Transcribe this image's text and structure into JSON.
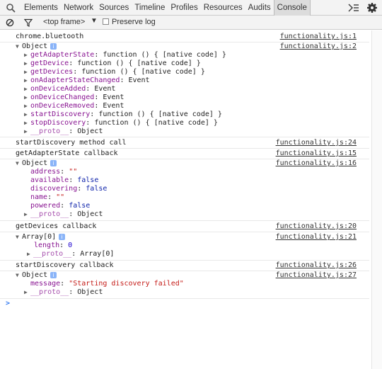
{
  "toolbar": {
    "tabs": [
      "Elements",
      "Network",
      "Sources",
      "Timeline",
      "Profiles",
      "Resources",
      "Audits",
      "Console"
    ],
    "active_tab": "Console"
  },
  "filterbar": {
    "context": "<top frame>",
    "preserve_log": "Preserve log"
  },
  "console": {
    "chrome_bluetooth": "chrome.bluetooth",
    "object": "Object",
    "members": [
      {
        "key": "getAdapterState",
        "value": ": function () { [native code] }"
      },
      {
        "key": "getDevice",
        "value": ": function () { [native code] }"
      },
      {
        "key": "getDevices",
        "value": ": function () { [native code] }"
      },
      {
        "key": "onAdapterStateChanged",
        "value": ": Event"
      },
      {
        "key": "onDeviceAdded",
        "value": ": Event"
      },
      {
        "key": "onDeviceChanged",
        "value": ": Event"
      },
      {
        "key": "onDeviceRemoved",
        "value": ": Event"
      },
      {
        "key": "startDiscovery",
        "value": ": function () { [native code] }"
      },
      {
        "key": "stopDiscovery",
        "value": ": function () { [native code] }"
      },
      {
        "key": "__proto__",
        "value": ": Object"
      }
    ],
    "start_call": "startDiscovery method call",
    "adapter_callback": "getAdapterState callback",
    "adapter_props": [
      {
        "key": "address",
        "value": "\"\"",
        "kind": "str"
      },
      {
        "key": "available",
        "value": "false",
        "kind": "kw"
      },
      {
        "key": "discovering",
        "value": "false",
        "kind": "kw"
      },
      {
        "key": "name",
        "value": "\"\"",
        "kind": "str"
      },
      {
        "key": "powered",
        "value": "false",
        "kind": "kw"
      }
    ],
    "proto": "__proto__",
    "proto_object": ": Object",
    "devices_callback": "getDevices callback",
    "array0": "Array[0]",
    "length_key": "length",
    "length_val": "0",
    "proto_array": ": Array[0]",
    "discovery_callback": "startDiscovery callback",
    "message_key": "message",
    "message_val": "\"Starting discovery failed\"",
    "prompt": ">",
    "sources": {
      "s1": "functionality.js:1",
      "s2": "functionality.js:2",
      "s24": "functionality.js:24",
      "s15": "functionality.js:15",
      "s16": "functionality.js:16",
      "s20": "functionality.js:20",
      "s21": "functionality.js:21",
      "s26": "functionality.js:26",
      "s27": "functionality.js:27"
    }
  }
}
